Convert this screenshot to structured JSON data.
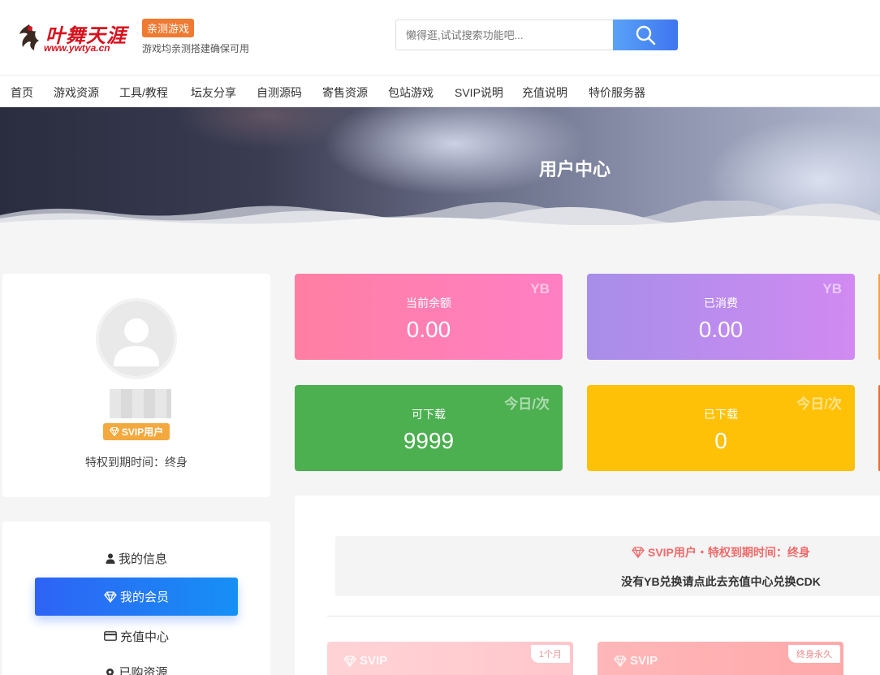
{
  "header": {
    "logo_text": "叶舞天涯",
    "logo_url": "www.ywtya.cn",
    "tag": "亲测游戏",
    "tagline": "游戏均亲测搭建确保可用",
    "search_placeholder": "懒得逛,试试搜索功能吧..."
  },
  "nav": {
    "items": [
      "首页",
      "游戏资源",
      "工具/教程",
      "坛友分享",
      "自测源码",
      "寄售资源",
      "包站游戏",
      "SVIP说明",
      "充值说明",
      "特价服务器"
    ]
  },
  "banner": {
    "title": "用户中心"
  },
  "profile": {
    "badge": "SVIP用户",
    "expire": "特权到期时间：终身"
  },
  "stats": [
    {
      "label": "当前余额",
      "value": "0.00",
      "unit": "YB"
    },
    {
      "label": "已消费",
      "value": "0.00",
      "unit": "YB"
    },
    {
      "label": "可下载",
      "value": "9999",
      "unit": "今日/次"
    },
    {
      "label": "已下载",
      "value": "0",
      "unit": "今日/次"
    }
  ],
  "menu": {
    "items": [
      {
        "label": "我的信息",
        "icon": "user-icon"
      },
      {
        "label": "我的会员",
        "icon": "diamond-icon"
      },
      {
        "label": "充值中心",
        "icon": "credit-card-icon"
      },
      {
        "label": "已购资源",
        "icon": "gear-icon"
      }
    ]
  },
  "notice": {
    "line1": "SVIP用户・特权到期时间：终身",
    "line2": "没有YB兑换请点此去充值中心兑换CDK"
  },
  "plans": [
    {
      "name": "SVIP",
      "term": "1个月"
    },
    {
      "name": "SVIP",
      "term": "终身永久"
    }
  ],
  "colors": {
    "accent": "#2e63f5",
    "balance": "#ff7fa3",
    "spent": "#b38df0",
    "downloadable": "#4caf50",
    "downloaded": "#ffc107",
    "tag": "#ef7a31",
    "svip_badge": "#f3a93d"
  }
}
